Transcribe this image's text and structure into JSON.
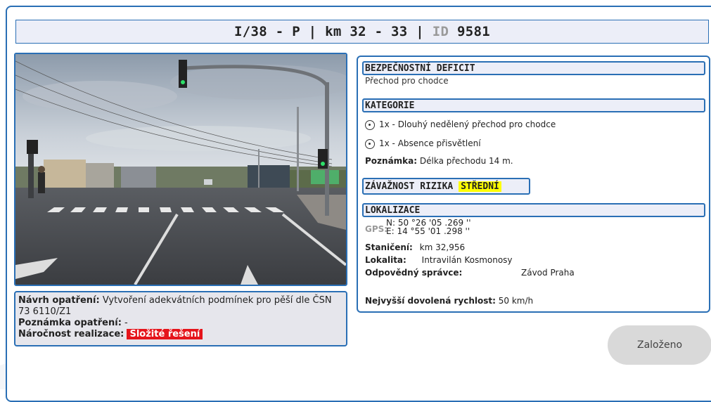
{
  "title": {
    "road": "I/38 - P | km 32 - 33 |",
    "id_label": "ID",
    "id_value": "9581"
  },
  "measure": {
    "proposal_label": "Návrh opatření:",
    "proposal_text": "Vytvoření adekvátních podmínek pro pěší dle ČSN 73 6110/Z1",
    "note_label": "Poznámka opatření:",
    "note_text": "-",
    "difficulty_label": "Náročnost realizace:",
    "difficulty_value": "Složité řešení"
  },
  "deficit": {
    "heading": "BEZPEČNOSTNÍ DEFICIT",
    "text": "Přechod pro chodce"
  },
  "category": {
    "heading": "KATEGORIE",
    "items": [
      "1x - Dlouhý nedělený přechod pro chodce",
      "1x - Absence přisvětlení"
    ],
    "note_label": "Poznámka:",
    "note_text": "Délka přechodu 14 m."
  },
  "risk": {
    "heading": "ZÁVAŽNOST RIZIKA",
    "value": "STŘEDNÍ",
    "color": "#ffff00"
  },
  "location": {
    "heading": "LOKALIZACE",
    "gps_label": "GPS:",
    "gps_n": "N: 50 °26 '05 .269 ''",
    "gps_e": "E: 14 °55 '01 .298 ''",
    "station_label": "Staničení:",
    "station_value": "km 32,956",
    "locality_label": "Lokalita:",
    "locality_value": "Intravilán Kosmonosy",
    "admin_label": "Odpovědný správce:",
    "admin_value": "Závod Praha",
    "speed_label": "Nejvyšší dovolená rychlost:",
    "speed_value": "50 km/h"
  },
  "status_button": "Založeno",
  "colors": {
    "accent": "#2a6fb5",
    "header_bg": "#eceef8",
    "danger": "#e5141b"
  }
}
